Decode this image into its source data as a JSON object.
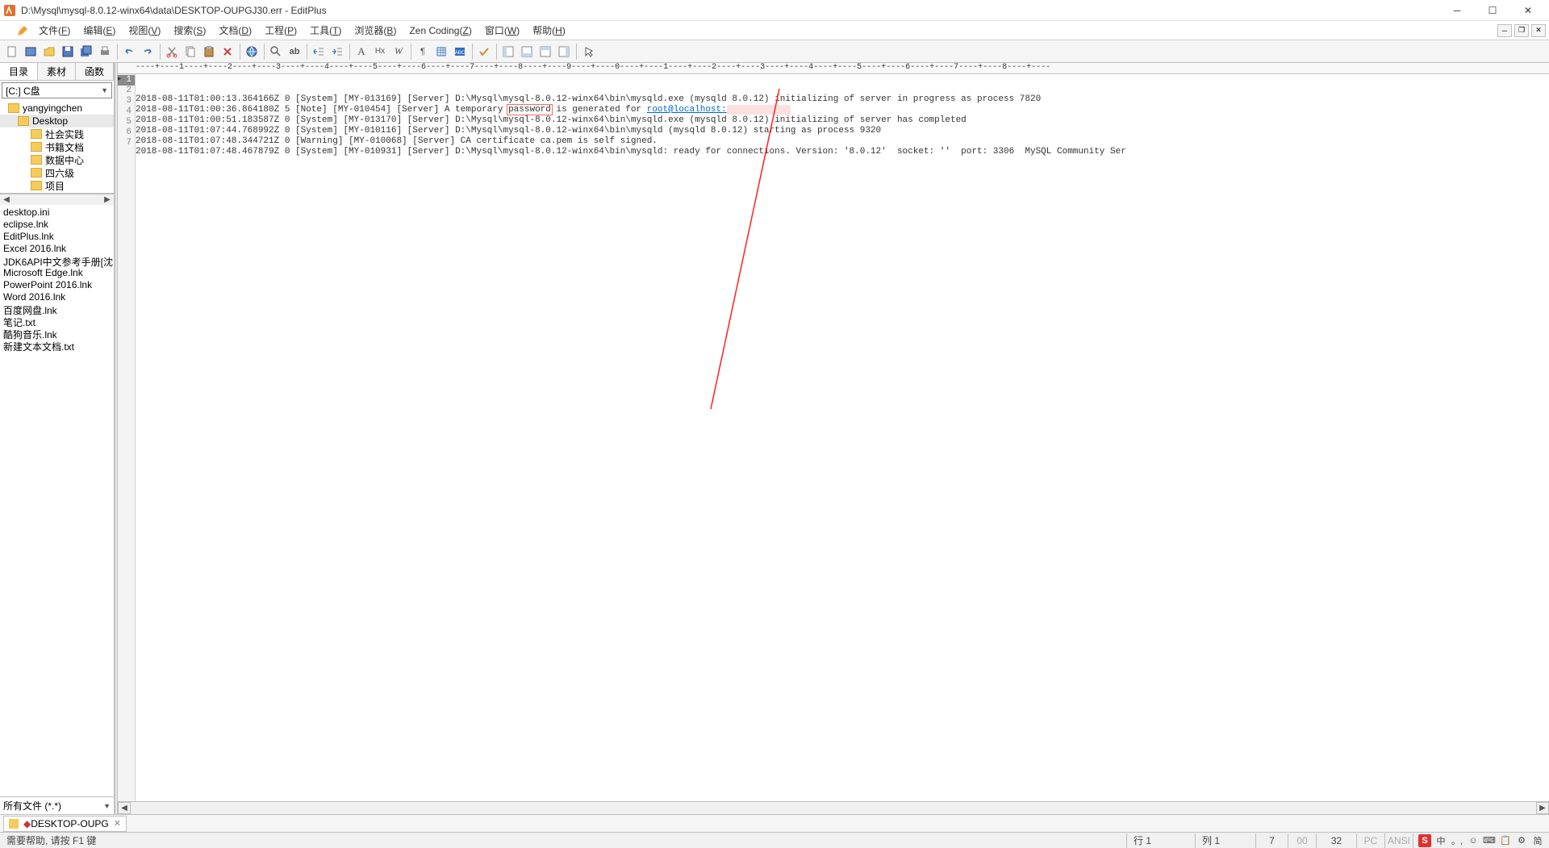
{
  "title": "D:\\Mysql\\mysql-8.0.12-winx64\\data\\DESKTOP-OUPGJ30.err - EditPlus",
  "menus": [
    {
      "label": "文件(",
      "u": "F",
      "tail": ")"
    },
    {
      "label": "编辑(",
      "u": "E",
      "tail": ")"
    },
    {
      "label": "视图(",
      "u": "V",
      "tail": ")"
    },
    {
      "label": "搜索(",
      "u": "S",
      "tail": ")"
    },
    {
      "label": "文档(",
      "u": "D",
      "tail": ")"
    },
    {
      "label": "工程(",
      "u": "P",
      "tail": ")"
    },
    {
      "label": "工具(",
      "u": "T",
      "tail": ")"
    },
    {
      "label": "浏览器(",
      "u": "B",
      "tail": ")"
    },
    {
      "label": "Zen Coding(",
      "u": "Z",
      "tail": ")"
    },
    {
      "label": "窗口(",
      "u": "W",
      "tail": ")"
    },
    {
      "label": "帮助(",
      "u": "H",
      "tail": ")"
    }
  ],
  "sidebar": {
    "tabs": [
      "目录",
      "素材",
      "函数"
    ],
    "drive": "[C:] C盘",
    "folders": [
      {
        "name": "yangyingchen",
        "depth": 0
      },
      {
        "name": "Desktop",
        "depth": 1,
        "selected": true
      },
      {
        "name": "社会实践",
        "depth": 2
      },
      {
        "name": "书籍文档",
        "depth": 2
      },
      {
        "name": "数据中心",
        "depth": 2
      },
      {
        "name": "四六级",
        "depth": 2
      },
      {
        "name": "项目",
        "depth": 2
      }
    ],
    "files": [
      "desktop.ini",
      "eclipse.lnk",
      "EditPlus.lnk",
      "Excel 2016.lnk",
      "JDK6API中文参考手册[沈",
      "Microsoft Edge.lnk",
      "PowerPoint 2016.lnk",
      "Word 2016.lnk",
      "百度网盘.lnk",
      "笔记.txt",
      "酷狗音乐.lnk",
      "新建文本文档.txt"
    ],
    "filter": "所有文件 (*.*)"
  },
  "ruler": "----+----1----+----2----+----3----+----4----+----5----+----6----+----7----+----8----+----9----+----0----+----1----+----2----+----3----+----4----+----5----+----6----+----7----+----8----+----",
  "code": {
    "lines": [
      {
        "n": 1,
        "pre": "2018-08-11T01:00:13.364166Z 0 [System] [MY-013169] [Server] D:\\Mysql\\mysql-8.0.12-winx64\\bin\\mysqld.exe (mysqld 8.0.12) initializing of server in progress as process 7820"
      },
      {
        "n": 2,
        "pre": "2018-08-11T01:00:36.864180Z 5 [Note] [MY-010454] [Server] A temporary ",
        "h": "password",
        "mid": " is generated for ",
        "link": "root@localhost:",
        "obs": "            "
      },
      {
        "n": 3,
        "pre": "2018-08-11T01:00:51.183587Z 0 [System] [MY-013170] [Server] D:\\Mysql\\mysql-8.0.12-winx64\\bin\\mysqld.exe (mysqld 8.0.12) initializing of server has completed"
      },
      {
        "n": 4,
        "pre": "2018-08-11T01:07:44.768992Z 0 [System] [MY-010116] [Server] D:\\Mysql\\mysql-8.0.12-winx64\\bin\\mysqld (mysqld 8.0.12) starting as process 9320"
      },
      {
        "n": 5,
        "pre": "2018-08-11T01:07:48.344721Z 0 [Warning] [MY-010068] [Server] CA certificate ca.pem is self signed."
      },
      {
        "n": 6,
        "pre": "2018-08-11T01:07:48.467879Z 0 [System] [MY-010931] [Server] D:\\Mysql\\mysql-8.0.12-winx64\\bin\\mysqld: ready for connections. Version: '8.0.12'  socket: ''  port: 3306  MySQL Community Ser"
      },
      {
        "n": 7,
        "pre": ""
      }
    ]
  },
  "doctab": {
    "name": "DESKTOP-OUPG",
    "modified": "◆"
  },
  "status": {
    "help": "需要帮助, 请按 F1 键",
    "row": "行 1",
    "col": "列 1",
    "n1": "7",
    "n2": "00",
    "n3": "32",
    "off1": "PC",
    "off2": "ANSI"
  },
  "tray": [
    "S",
    "中",
    "。, ",
    "☺",
    "⌨",
    "📋",
    "⚙",
    "简"
  ]
}
